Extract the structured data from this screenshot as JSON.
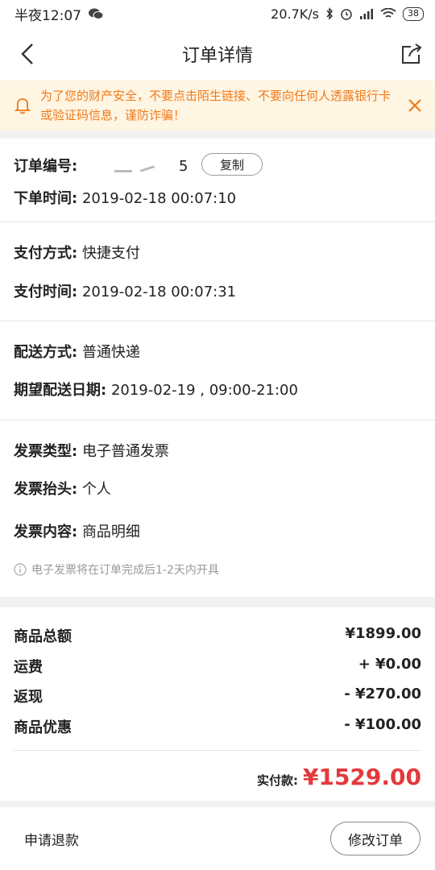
{
  "status_bar": {
    "time": "半夜12:07",
    "speed": "20.7K/s",
    "battery": "38",
    "icons": [
      "wechat-icon",
      "bluetooth-icon",
      "alarm-icon",
      "signal-icon",
      "wifi-icon",
      "battery-icon"
    ]
  },
  "nav": {
    "title": "订单详情",
    "icons": [
      "back-arrow-icon",
      "share-icon"
    ]
  },
  "notice": {
    "text": "为了您的财产安全，不要点击陌生链接、不要向任何人透露银行卡或验证码信息，谨防诈骗！",
    "icons": [
      "bell-icon",
      "close-icon"
    ]
  },
  "order": {
    "number_label": "订单编号:",
    "number_tail": "5",
    "copy_label": "复制",
    "time_label": "下单时间:",
    "time_value": "2019-02-18 00:07:10"
  },
  "payment": {
    "method_label": "支付方式:",
    "method_value": "快捷支付",
    "time_label": "支付时间:",
    "time_value": "2019-02-18 00:07:31"
  },
  "delivery": {
    "method_label": "配送方式:",
    "method_value": "普通快递",
    "date_label": "期望配送日期:",
    "date_value": "2019-02-19 , 09:00-21:00"
  },
  "invoice": {
    "type_label": "发票类型:",
    "type_value": "电子普通发票",
    "title_label": "发票抬头:",
    "title_value": "个人",
    "content_label": "发票内容:",
    "content_value": "商品明细",
    "tip": "电子发票将在订单完成后1-2天内开具"
  },
  "summary": {
    "rows": [
      {
        "label": "商品总额",
        "value": "¥1899.00"
      },
      {
        "label": "运费",
        "value": "+ ¥0.00"
      },
      {
        "label": "返现",
        "value": "- ¥270.00"
      },
      {
        "label": "商品优惠",
        "value": "- ¥100.00"
      }
    ],
    "paid_label": "实付款:",
    "paid_value": "¥1529.00"
  },
  "colors": {
    "accent_red": "#e4393c",
    "notice_orange": "#f07a1a",
    "notice_bg": "#fff5e3"
  },
  "bottom": {
    "refund_label": "申请退款",
    "modify_label": "修改订单"
  }
}
